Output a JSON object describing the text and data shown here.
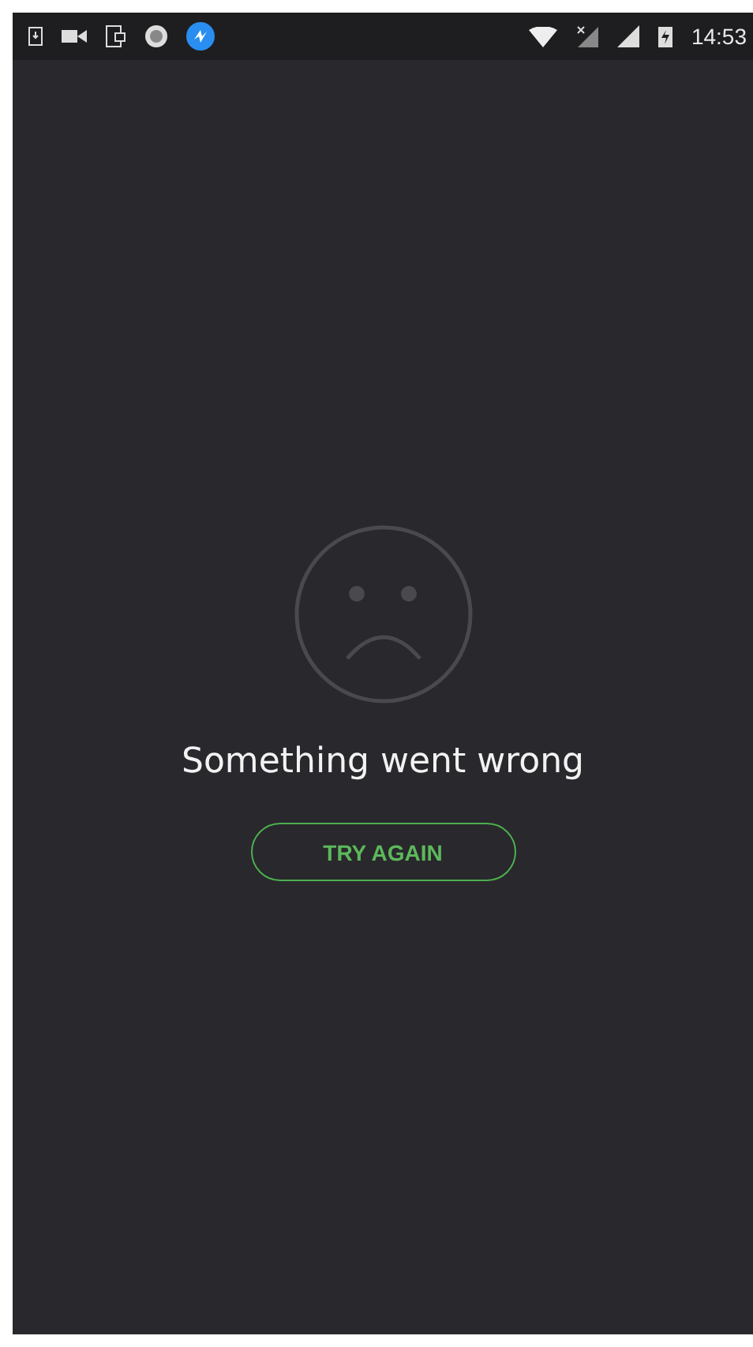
{
  "status_bar": {
    "time": "14:53"
  },
  "error": {
    "message": "Something went wrong",
    "button": "TRY AGAIN"
  }
}
